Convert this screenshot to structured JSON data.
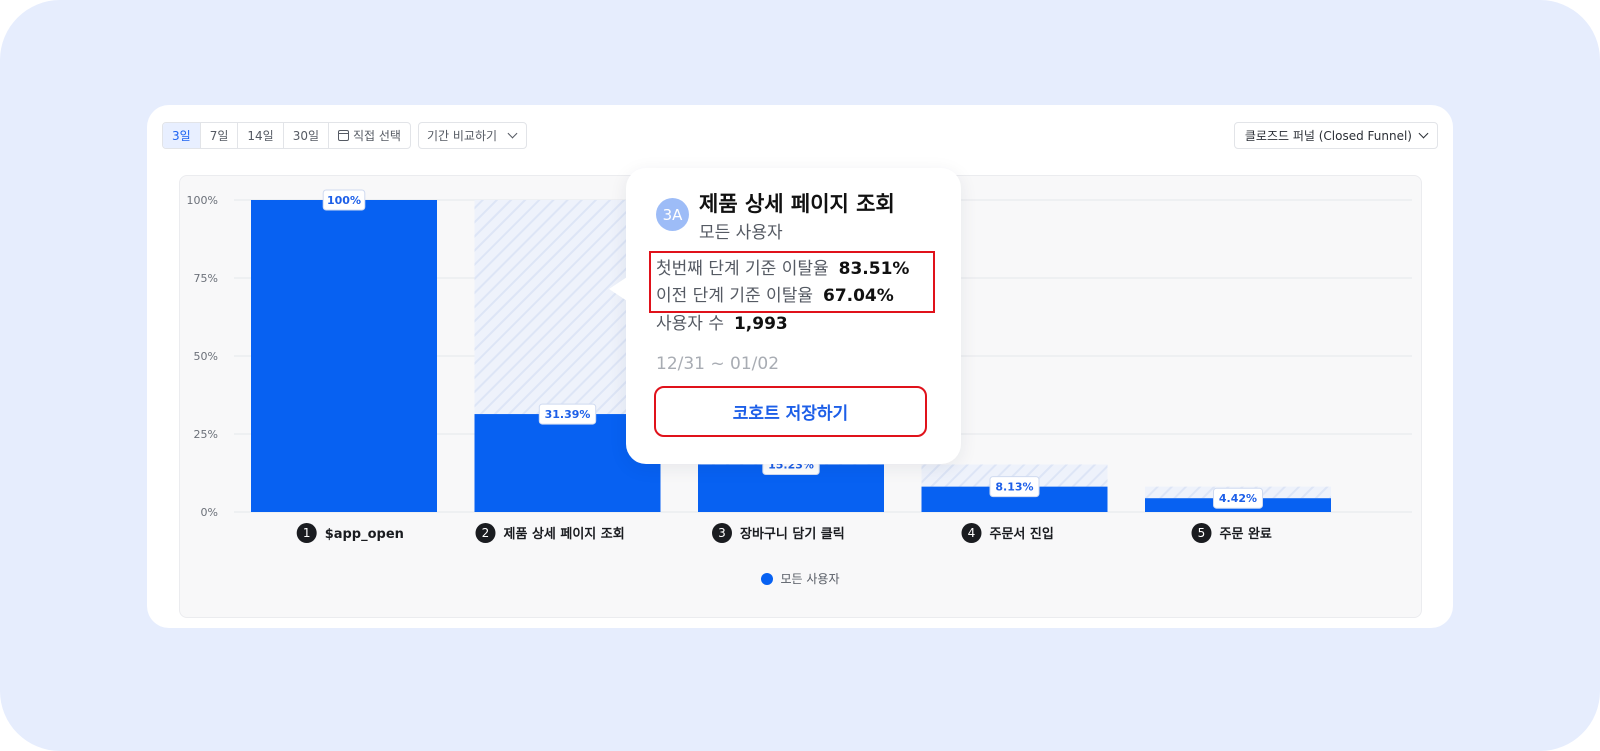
{
  "toolbar": {
    "range_buttons": [
      "3일",
      "7일",
      "14일",
      "30일",
      "직접 선택"
    ],
    "active_range": "3일",
    "compare_label": "기간 비교하기",
    "funnel_type": "클로즈드 퍼널 (Closed Funnel)"
  },
  "legend": {
    "label": "모든 사용자"
  },
  "tooltip": {
    "badge": "3A",
    "title": "제품 상세 페이지 조회",
    "subtitle": "모든 사용자",
    "first_step_dropoff_label": "첫번째 단계 기준 이탈율",
    "first_step_dropoff_value": "83.51%",
    "prev_step_dropoff_label": "이전 단계 기준 이탈율",
    "prev_step_dropoff_value": "67.04%",
    "users_label": "사용자 수",
    "users_value": "1,993",
    "date_range": "12/31 ~ 01/02",
    "save_cohort_label": "코호트 저장하기"
  },
  "colors": {
    "bar": "#0761f2",
    "dropoff_hatch": "#dde5f6",
    "highlight_border": "#e0121b",
    "accent": "#1d63f2"
  },
  "chart_data": {
    "type": "bar",
    "categories": [
      "$app_open",
      "제품 상세 페이지 조회",
      "장바구니 담기 클릭",
      "주문서 진입",
      "주문 완료"
    ],
    "step_numbers": [
      "1",
      "2",
      "3",
      "4",
      "5"
    ],
    "series": [
      {
        "name": "모든 사용자",
        "values": [
          100,
          31.39,
          15.23,
          8.13,
          4.42
        ]
      }
    ],
    "previous_step_values": [
      100,
      100,
      31.39,
      15.23,
      8.13
    ],
    "data_labels": [
      "100%",
      "31.39%",
      "15.23%",
      "8.13%",
      "4.42%"
    ],
    "y_ticks": [
      "100%",
      "75%",
      "50%",
      "25%",
      "0%"
    ],
    "ylim": [
      0,
      100
    ],
    "grid": true,
    "legend_position": "bottom"
  }
}
